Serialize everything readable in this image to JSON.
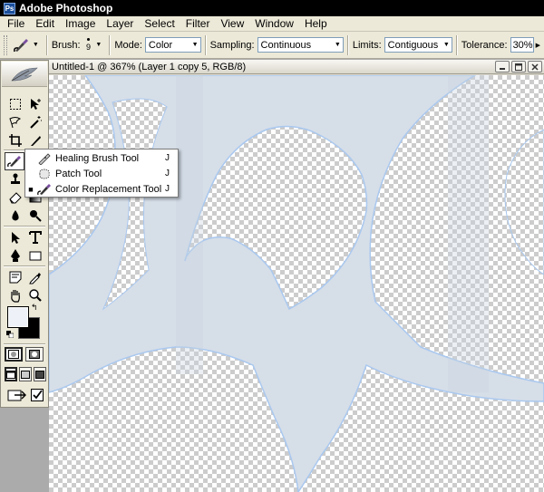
{
  "app": {
    "title": "Adobe Photoshop",
    "logo_text": "Ps"
  },
  "menu": [
    "File",
    "Edit",
    "Image",
    "Layer",
    "Select",
    "Filter",
    "View",
    "Window",
    "Help"
  ],
  "options": {
    "brush_label": "Brush:",
    "brush_size": "9",
    "mode_label": "Mode:",
    "mode_value": "Color",
    "sampling_label": "Sampling:",
    "sampling_value": "Continuous",
    "limits_label": "Limits:",
    "limits_value": "Contiguous",
    "tolerance_label": "Tolerance:",
    "tolerance_value": "30%"
  },
  "document": {
    "title": "Untitled-1 @ 367% (Layer 1 copy 5, RGB/8)"
  },
  "flyout": [
    {
      "label": "Healing Brush Tool",
      "shortcut": "J",
      "selected": false,
      "icon": "healing-brush-icon"
    },
    {
      "label": "Patch Tool",
      "shortcut": "J",
      "selected": false,
      "icon": "patch-icon"
    },
    {
      "label": "Color Replacement Tool",
      "shortcut": "J",
      "selected": true,
      "icon": "color-replacement-icon"
    }
  ],
  "colors": {
    "foreground": "#eef2f8",
    "background": "#000000",
    "shape_fill": "#d6dee8",
    "shape_edge": "#a9c8ef"
  }
}
